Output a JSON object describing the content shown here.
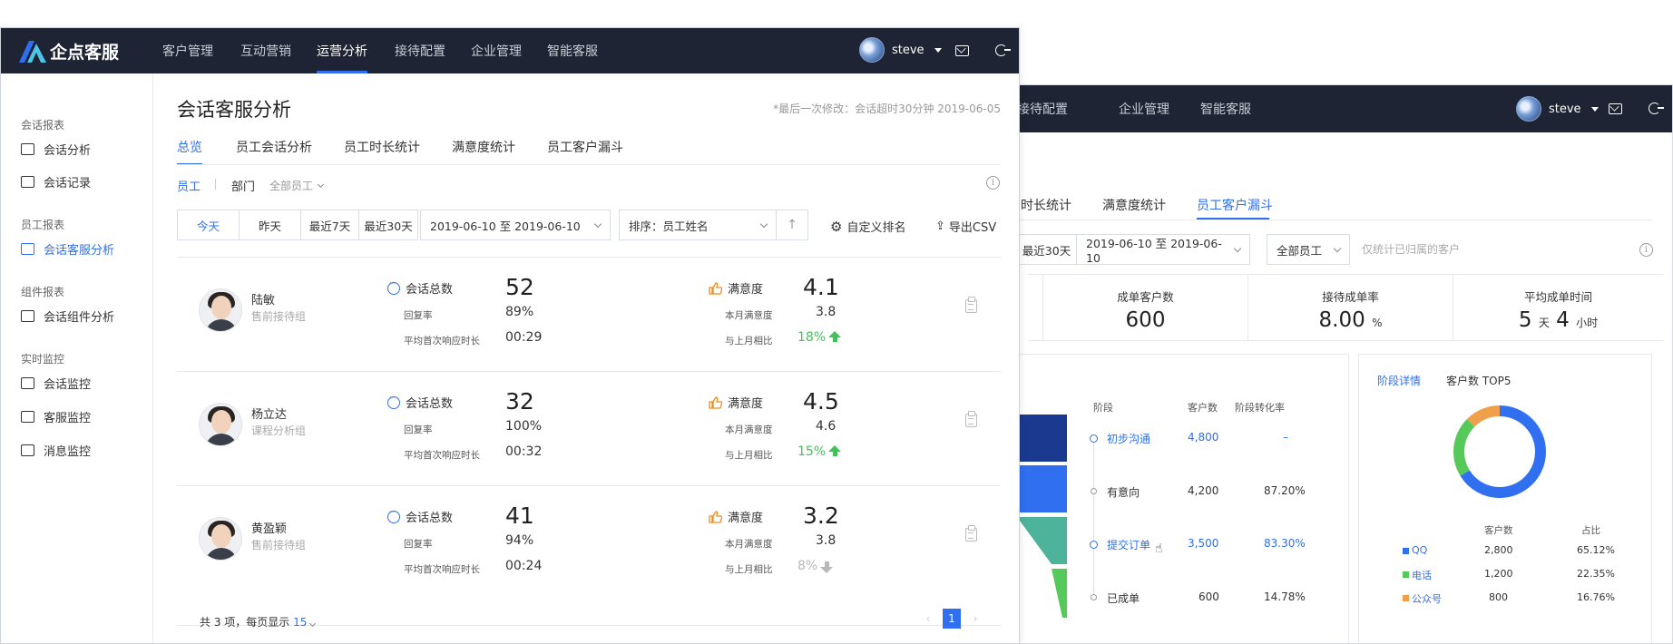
{
  "colors": {
    "topbar": "#1e2433",
    "accent": "#2f6ff0",
    "up": "#43c15b",
    "down": "#b8b8b8"
  },
  "front": {
    "brand": "企点客服",
    "nav": [
      "客户管理",
      "互动营销",
      "运营分析",
      "接待配置",
      "企业管理",
      "智能客服"
    ],
    "nav_active_index": 2,
    "user": "steve",
    "sidebar": {
      "groups": [
        {
          "title": "会话报表",
          "items": [
            "会话分析",
            "会话记录"
          ]
        },
        {
          "title": "员工报表",
          "items": [
            "会话客服分析"
          ]
        },
        {
          "title": "组件报表",
          "items": [
            "会话组件分析"
          ]
        },
        {
          "title": "实时监控",
          "items": [
            "会话监控",
            "客服监控",
            "消息监控"
          ]
        }
      ],
      "active": "会话客服分析"
    },
    "title": "会话客服分析",
    "modified": "*最后一次修改：会话超时30分钟 2019-06-05",
    "tabs": [
      "总览",
      "员工会话分析",
      "员工时长统计",
      "满意度统计",
      "员工客户漏斗"
    ],
    "filter": {
      "employee": "员工",
      "department": "部门",
      "all_employees": "全部员工"
    },
    "date_buttons": [
      "今天",
      "昨天",
      "最近7天",
      "最近30天"
    ],
    "date_range": "2019-06-10 至 2019-06-10",
    "sort": "排序：员工姓名",
    "custom_rank": "自定义排名",
    "export": "导出CSV",
    "metric_labels": {
      "total": "会话总数",
      "reply_rate": "回复率",
      "avg_first_resp": "平均首次响应时长",
      "satisfaction": "满意度",
      "month_sat": "本月满意度",
      "vs_last_month": "与上月相比"
    },
    "employees": [
      {
        "name": "陆敏",
        "group": "售前接待组",
        "total": "52",
        "reply_rate": "89%",
        "avg_first_resp": "00:29",
        "satisfaction": "4.1",
        "month_sat": "3.8",
        "change": "18%",
        "trend": "up"
      },
      {
        "name": "杨立达",
        "group": "课程分析组",
        "total": "32",
        "reply_rate": "100%",
        "avg_first_resp": "00:32",
        "satisfaction": "4.5",
        "month_sat": "4.6",
        "change": "15%",
        "trend": "up"
      },
      {
        "name": "黄盈颖",
        "group": "售前接待组",
        "total": "41",
        "reply_rate": "94%",
        "avg_first_resp": "00:24",
        "satisfaction": "3.2",
        "month_sat": "3.8",
        "change": "8%",
        "trend": "down"
      }
    ],
    "footer": {
      "summary": "共 3 项，每页显示",
      "page_size": "15",
      "page": "1"
    }
  },
  "back": {
    "nav": [
      "接待配置",
      "企业管理",
      "智能客服"
    ],
    "user": "steve",
    "tabs": [
      "时长统计",
      "满意度统计",
      "员工客户漏斗"
    ],
    "tab_active_index": 2,
    "date_btn": "最近30天",
    "date_range": "2019-06-10 至 2019-06-10",
    "employees_select": "全部员工",
    "hint": "仅统计已归属的客户",
    "stats": [
      {
        "label": "成单客户数",
        "value": "600",
        "unit": ""
      },
      {
        "label": "接待成单率",
        "value": "8.00",
        "unit": "%"
      },
      {
        "label": "平均成单时间",
        "value_days": "5",
        "unit_days": "天",
        "value_hours": "4",
        "unit_hours": "小时"
      }
    ],
    "funnel": {
      "headers": [
        "阶段",
        "客户数",
        "阶段转化率"
      ],
      "rows": [
        {
          "stage": "初步沟通",
          "customers": "4,800",
          "rate": "–",
          "highlight": true,
          "color": "#1a3a8f"
        },
        {
          "stage": "有意向",
          "customers": "4,200",
          "rate": "87.20%",
          "highlight": false,
          "color": "#2f6ff0"
        },
        {
          "stage": "提交订单",
          "customers": "3,500",
          "rate": "83.30%",
          "highlight": true,
          "color": "#4db39a"
        },
        {
          "stage": "已成单",
          "customers": "600",
          "rate": "14.78%",
          "highlight": false,
          "color": "#55c95a"
        }
      ]
    },
    "detail": {
      "tab_active": "阶段详情",
      "tab2": "客户数 TOP5",
      "headers": [
        "客户数",
        "占比"
      ],
      "rows": [
        {
          "channel": "QQ",
          "count": "2,800",
          "share": "65.12%",
          "color": "#2f6ff0"
        },
        {
          "channel": "电话",
          "count": "1,200",
          "share": "22.35%",
          "color": "#55c95a"
        },
        {
          "channel": "公众号",
          "count": "800",
          "share": "16.76%",
          "color": "#f0a04b"
        }
      ]
    }
  }
}
